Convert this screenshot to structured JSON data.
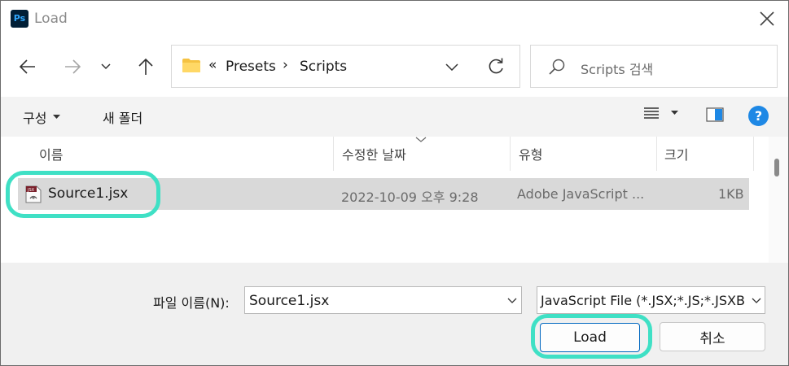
{
  "window": {
    "app_icon_text": "Ps",
    "title": "Load"
  },
  "address_bar": {
    "overflow": "«",
    "crumbs": [
      "Presets",
      "Scripts"
    ],
    "separator": "›"
  },
  "search": {
    "placeholder": "Scripts 검색"
  },
  "toolbar": {
    "organize": "구성",
    "new_folder": "새 폴더",
    "help": "?"
  },
  "columns": {
    "name": "이름",
    "date_modified": "수정한 날짜",
    "type": "유형",
    "size": "크기"
  },
  "files": [
    {
      "name": "Source1.jsx",
      "date": "2022-10-09 오후 9:28",
      "type": "Adobe JavaScript ...",
      "size": "1KB",
      "icon_label": "JSX"
    }
  ],
  "bottom": {
    "file_name_label": "파일 이름(N):",
    "file_name_value": "Source1.jsx",
    "file_type_filter": "JavaScript File (*.JSX;*.JS;*.JSXB",
    "load_button": "Load",
    "cancel_button": "취소"
  },
  "colors": {
    "accent": "#0067c0",
    "highlight": "#3fe0c5",
    "selected_row": "#d9d9d9",
    "help": "#1e88e5",
    "folder": "#f5c242"
  }
}
